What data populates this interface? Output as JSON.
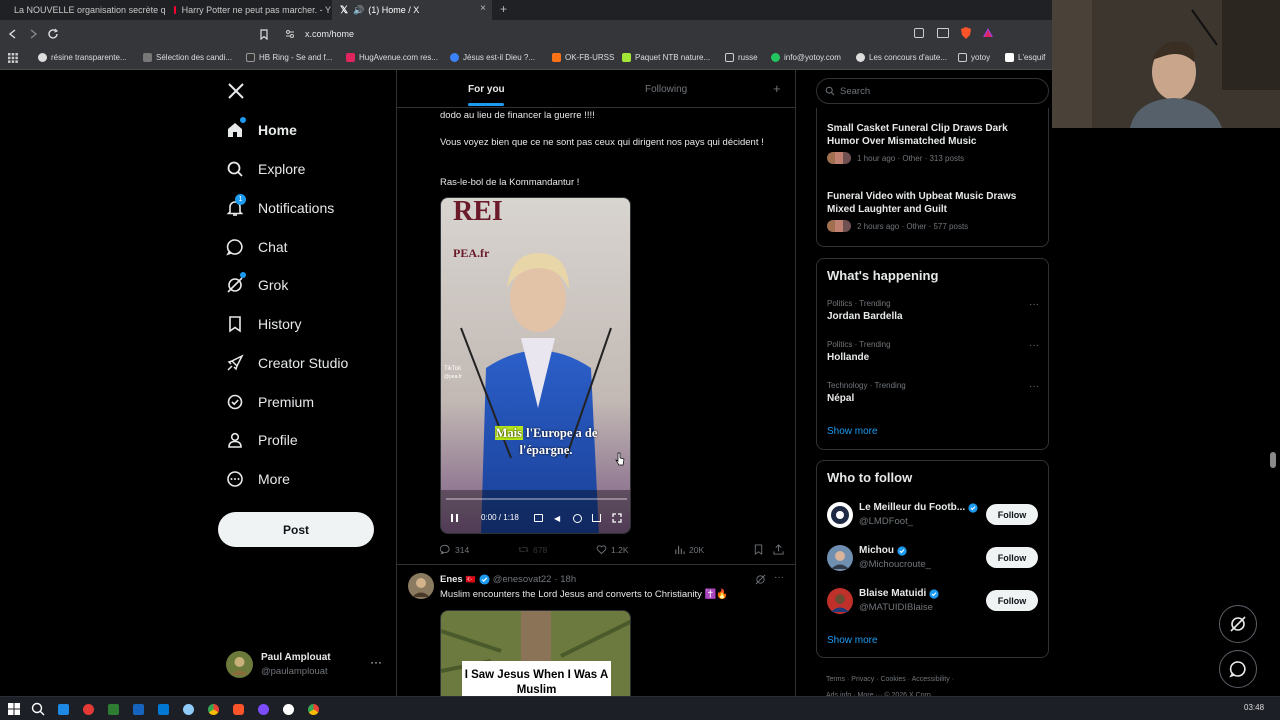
{
  "browser": {
    "tabs": [
      {
        "title": "La NOUVELLE organisation secrète q",
        "color": "#ff0033",
        "active": false
      },
      {
        "title": "Harry Potter ne peut pas marcher. - Y",
        "color": "#ff0033",
        "active": false
      },
      {
        "title": "(1) Home / X",
        "color": "#ffffff",
        "active": true
      }
    ],
    "tab_add": "+",
    "tab_close": "×",
    "url": "x.com/home",
    "bookmarks": [
      "résine transparente...",
      "Sélection des candi...",
      "HB Ring - Se and f...",
      "HugAvenue.com res...",
      "Jésus est-il Dieu ?...",
      "OK-FB-URSS",
      "Paquet NTB nature...",
      "russe",
      "info@yotoy.com",
      "Les concours d'aute...",
      "yotoy",
      "L'esquif"
    ]
  },
  "nav": {
    "items": [
      {
        "label": "Home",
        "icon": "home-icon"
      },
      {
        "label": "Explore",
        "icon": "search-icon"
      },
      {
        "label": "Notifications",
        "icon": "bell-icon",
        "badge": "1"
      },
      {
        "label": "Chat",
        "icon": "chat-icon"
      },
      {
        "label": "Grok",
        "icon": "grok-icon"
      },
      {
        "label": "History",
        "icon": "bookmark-icon"
      },
      {
        "label": "Creator Studio",
        "icon": "rocket-icon"
      },
      {
        "label": "Premium",
        "icon": "verified-icon"
      },
      {
        "label": "Profile",
        "icon": "person-icon"
      },
      {
        "label": "More",
        "icon": "more-circle-icon"
      }
    ],
    "post_label": "Post",
    "account": {
      "name": "Paul Amplouat",
      "handle": "@paulamplouat"
    }
  },
  "feed": {
    "tabs": {
      "for_you": "For you",
      "following": "Following"
    },
    "post1": {
      "line1": "dodo au lieu de financer la guerre !!!!",
      "line2": "Vous voyez bien que ce ne sont pas ceux qui dirigent nos pays qui décident !",
      "line3": "Ras-le-bol de la Kommandantur !",
      "video": {
        "caption_highlight": "Mais",
        "caption_rest": "l'Europe a de l'épargne.",
        "brand": "PEA.fr",
        "tiktok": "TikTok",
        "tiktok_handle": "@pea.fr",
        "time": "0:00 / 1:18",
        "progress_fraction": 0.0
      },
      "actions": {
        "replies": "314",
        "reposts": "678",
        "likes": "1.2K",
        "views": "20K"
      }
    },
    "post2": {
      "name": "Enes",
      "flag": "🇹🇷",
      "handle": "@enesovat22",
      "time": "· 18h",
      "text": "Muslim encounters the Lord Jesus and converts to Christianity ✝️🔥",
      "image_text": "I Saw Jesus When I Was A Muslim"
    }
  },
  "right": {
    "search_placeholder": "Search",
    "news": [
      {
        "title": "Small Casket Funeral Clip Draws Dark Humor Over Mismatched Music",
        "meta": "1 hour ago · Other · 313 posts"
      },
      {
        "title": "Funeral Video with Upbeat Music Draws Mixed Laughter and Guilt",
        "meta": "2 hours ago · Other · 577 posts"
      }
    ],
    "happening_title": "What's happening",
    "trends": [
      {
        "meta": "Politics · Trending",
        "name": "Jordan Bardella"
      },
      {
        "meta": "Politics · Trending",
        "name": "Hollande"
      },
      {
        "meta": "Technology · Trending",
        "name": "Népal"
      }
    ],
    "show_more": "Show more",
    "wtf_title": "Who to follow",
    "follow_label": "Follow",
    "suggestions": [
      {
        "name": "Le Meilleur du Footb...",
        "handle": "@LMDFoot_"
      },
      {
        "name": "Michou",
        "handle": "@Michoucroute_"
      },
      {
        "name": "Blaise Matuidi",
        "handle": "@MATUIDIBlaise"
      }
    ],
    "footer": [
      "Terms",
      "Privacy",
      "Cookies",
      "Accessibility",
      "Ads info",
      "More ···",
      "© 2026 X Corp."
    ]
  },
  "taskbar": {
    "clock": "03:48"
  }
}
